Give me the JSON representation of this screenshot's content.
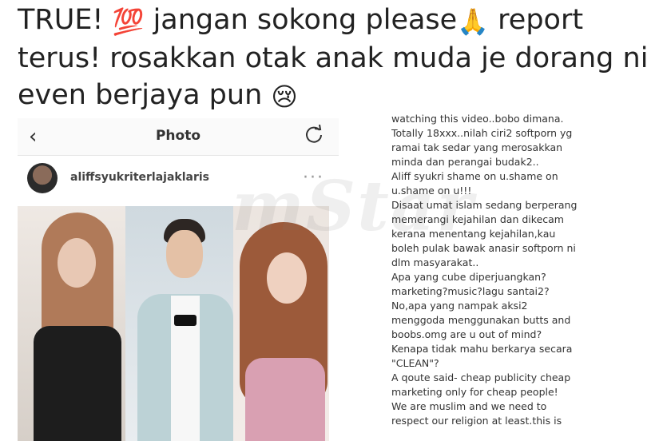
{
  "headline": {
    "line1_a": "TRUE! ",
    "emoji_100": "💯",
    "line1_b": " jangan sokong please",
    "emoji_pray": "🙏",
    "line1_c": " report",
    "line2": "terus! rosakkan otak anak muda je dorang ni",
    "line3": "even berjaya pun ",
    "emoji_cry": "😢"
  },
  "post": {
    "title": "Photo",
    "username": "aliffsyukriterlajaklaris",
    "more": "···",
    "back_icon": "chevron-left-icon",
    "refresh_icon": "refresh-icon"
  },
  "watermark": "mStar",
  "comments": [
    "watching this video..bobo dimana.",
    "Totally 18xxx..nilah ciri2 softporn yg",
    "ramai tak sedar yang merosakkan",
    "minda dan perangai budak2..",
    "Aliff syukri shame on u.shame on",
    "u.shame on u!!!",
    "Disaat umat islam sedang berperang",
    "memerangi kejahilan dan dikecam",
    "kerana menentang kejahilan,kau",
    "boleh pulak bawak anasir softporn ni",
    "dlm masyarakat..",
    "Apa yang cube diperjuangkan?",
    "marketing?music?lagu santai2?",
    "No,apa yang nampak aksi2",
    "menggoda menggunakan butts and",
    "boobs.omg are u out of mind?",
    "Kenapa tidak mahu berkarya secara",
    "\"CLEAN\"?",
    "A qoute said- cheap publicity cheap",
    "marketing only for cheap people!",
    "We are muslim and we need to",
    "respect our religion at least.this is"
  ]
}
